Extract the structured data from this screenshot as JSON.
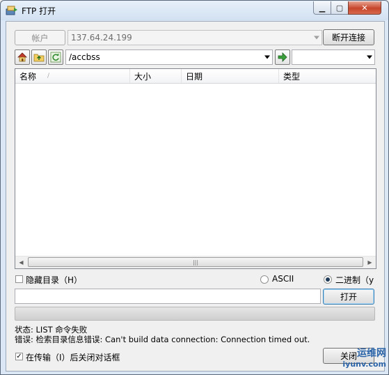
{
  "window": {
    "title": "FTP 打开"
  },
  "connection": {
    "account_label": "帐户",
    "host_value": "137.64.24.199",
    "disconnect_label": "断开连接"
  },
  "path": {
    "current": "/accbss"
  },
  "table": {
    "columns": [
      "名称",
      "大小",
      "日期",
      "类型"
    ],
    "sort_indicator": "/",
    "rows": []
  },
  "options": {
    "hide_dirs_label": "隐藏目录（H）",
    "ascii_label": "ASCII",
    "binary_label": "二进制（y",
    "mode_selected": "binary",
    "close_after_label": "在传输（I）后关闭对话框",
    "close_after_checked": true
  },
  "file_input": {
    "value": ""
  },
  "actions": {
    "open_label": "打开",
    "close_label": "关闭"
  },
  "status": {
    "line1": "状态: LIST 命令失败",
    "line2": "错误: 检索目录信息错误: Can't build data connection: Connection timed out."
  },
  "watermark": {
    "line1": "运维网",
    "line2": "iyunv.com"
  }
}
